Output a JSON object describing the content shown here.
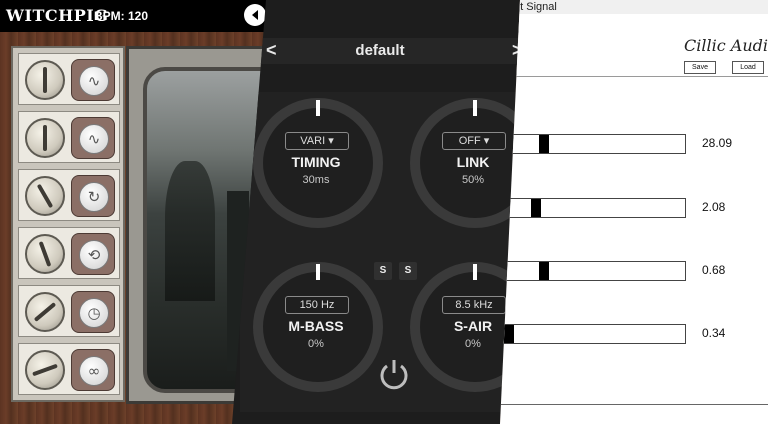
{
  "witchpig": {
    "logo": "WITCHPIG",
    "bpm": "BPM: 120",
    "rows": [
      {
        "glyph": "∿"
      },
      {
        "glyph": "∿"
      },
      {
        "glyph": "↻"
      },
      {
        "glyph": "⟲"
      },
      {
        "glyph": "◷"
      },
      {
        "glyph": "∞"
      }
    ]
  },
  "plugin": {
    "preset": "default",
    "prev_label": "<",
    "next_label": ">",
    "knobs": {
      "timing": {
        "label": "TIMING",
        "value": "30ms",
        "selector": "VARI ▾"
      },
      "link": {
        "label": "LINK",
        "value": "50%",
        "selector": "OFF ▾"
      },
      "mbass": {
        "label": "M-BASS",
        "value": "0%",
        "freq": "150 Hz"
      },
      "sair": {
        "label": "S-AIR",
        "value": "0%",
        "freq": "8.5 kHz"
      }
    },
    "solo_left": "S",
    "solo_right": "S"
  },
  "cillic": {
    "window_title": "ut Signal",
    "brand": "Cillic Audio",
    "save_label": "Save",
    "load_label": "Load",
    "sliders": [
      {
        "value": "28.09",
        "level": 0.22
      },
      {
        "value": "2.08",
        "level": 0.17
      },
      {
        "value": "0.68",
        "level": 0.22
      },
      {
        "value": "0.34",
        "level": 0.02
      }
    ]
  }
}
